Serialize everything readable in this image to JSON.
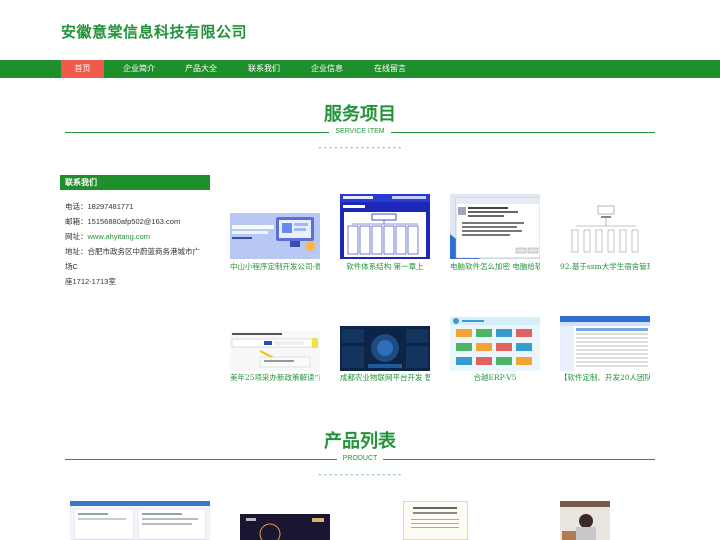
{
  "site": {
    "title": "安徽意棠信息科技有限公司"
  },
  "nav": [
    "首页",
    "企业简介",
    "产品大全",
    "联系我们",
    "企业信息",
    "在线留言"
  ],
  "services": {
    "title": "服务项目",
    "subtitle": "SERVICE ITEM",
    "dash": "----------------",
    "items": [
      {
        "caption": "中山小程序定制开发公司-微"
      },
      {
        "caption": "软件体系结构 第一章上"
      },
      {
        "caption": "电脑软件怎么加密 电脑给软"
      },
      {
        "caption": "92.基于ssm大学生宿舍管理"
      },
      {
        "caption": "美年25项采办新政策解读“量"
      },
      {
        "caption": "成都农业物联网平台开发 智"
      },
      {
        "caption": "合越ERP-V5"
      },
      {
        "caption": "【软件定制、开发20人团队"
      }
    ]
  },
  "contact": {
    "heading": "联系我们",
    "phone": "电话：18297481771",
    "email": "邮箱：15156880afp502@163.com",
    "website_label": "网址：",
    "website": "www.ahyitang.com",
    "address_line1": "地址：合肥市政务区中蔚蓝商务港城市广场C",
    "address_line2": "座1712-1713室"
  },
  "products": {
    "title": "产品列表",
    "subtitle": "PRODUCT",
    "dash": "----------------"
  },
  "colors": {
    "brand": "#1f8f2b",
    "accent": "#23933a",
    "nav_active": "#f05a4a"
  }
}
